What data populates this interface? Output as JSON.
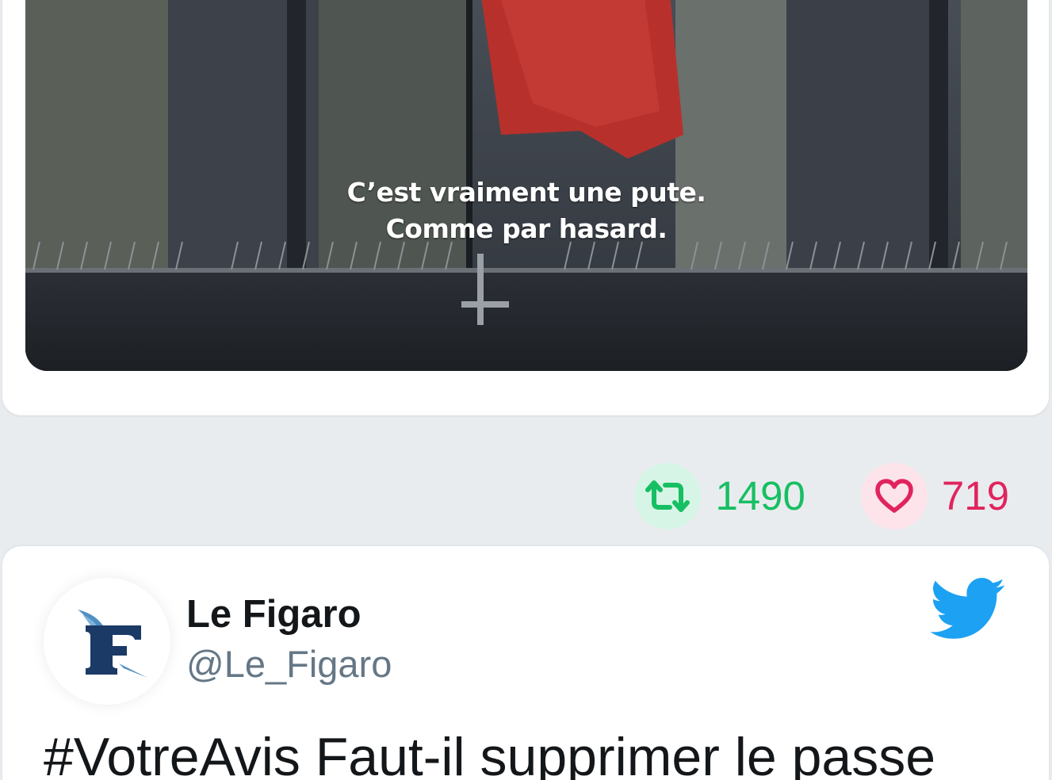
{
  "first_tweet": {
    "video_subtitle_line1": "C’est vraiment une pute.",
    "video_subtitle_line2": "Comme par hasard.",
    "retweet_count": "1490",
    "like_count": "719",
    "icons": {
      "retweet": "retweet-icon",
      "like": "heart-icon"
    }
  },
  "second_tweet": {
    "author_name": "Le Figaro",
    "author_handle": "@Le_Figaro",
    "text": "#VotreAvis Faut-il supprimer le passe",
    "icons": {
      "avatar": "le-figaro-logo",
      "platform": "twitter-bird-icon"
    }
  },
  "colors": {
    "page_background": "#e9ecef",
    "retweet_green": "#17bf63",
    "like_red": "#e0245e",
    "twitter_blue": "#1da1f2",
    "handle_gray": "#657786"
  }
}
